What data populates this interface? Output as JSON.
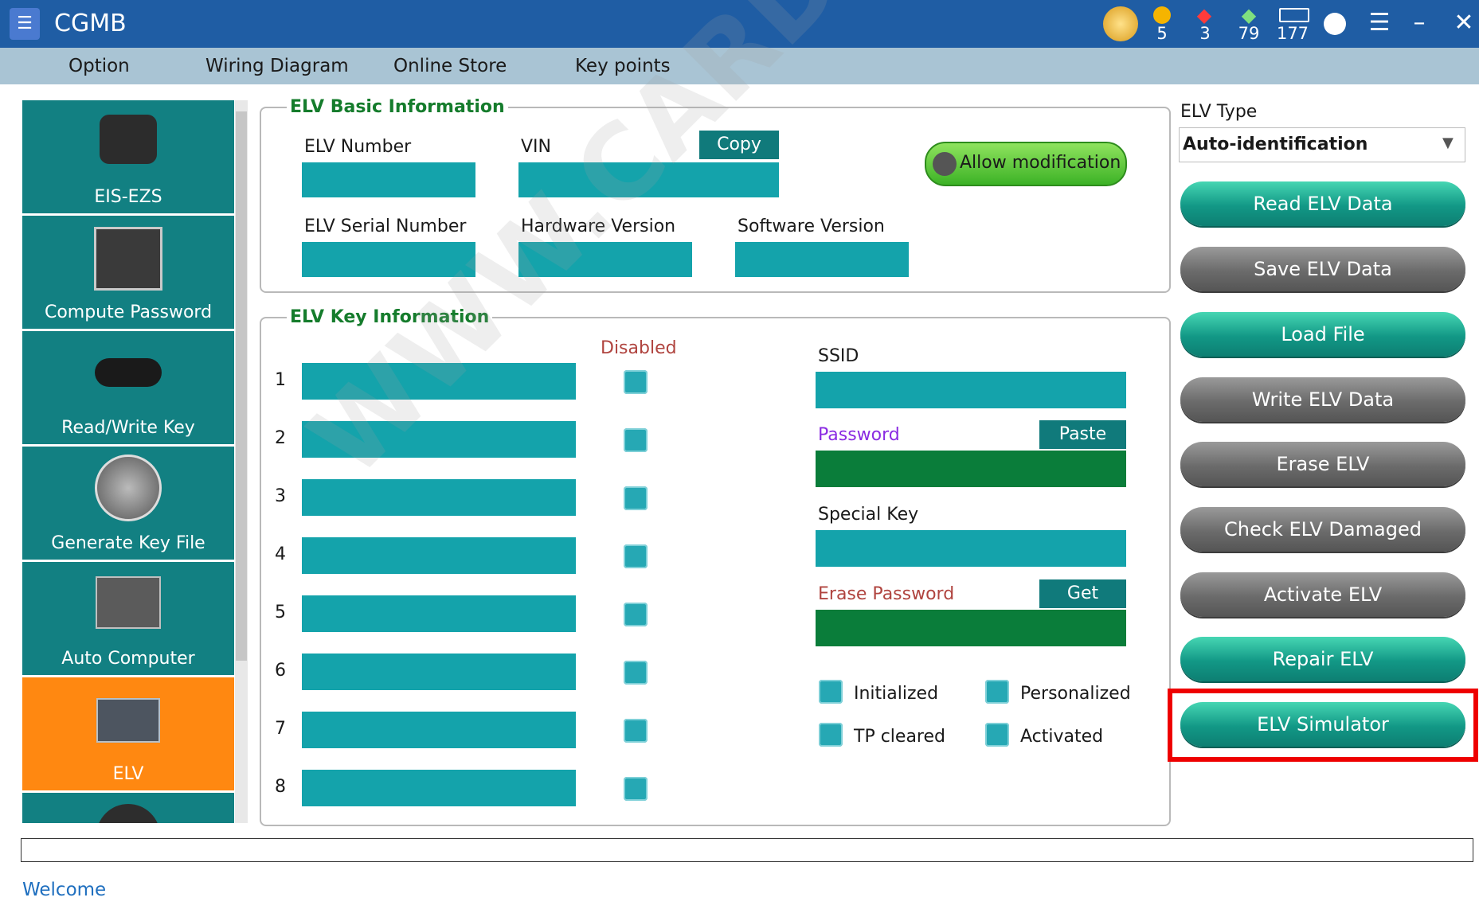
{
  "app": {
    "title": "CGMB",
    "counters": [
      {
        "icon": "gold-coin-icon",
        "value": "5"
      },
      {
        "icon": "red-gem-icon",
        "value": "3"
      },
      {
        "icon": "green-gem-icon",
        "value": "79"
      },
      {
        "icon": "chip-icon",
        "value": "177"
      }
    ]
  },
  "menu": [
    "Option",
    "Wiring Diagram",
    "Online Store",
    "Key points"
  ],
  "sidebar": {
    "items": [
      {
        "label": "EIS-EZS",
        "icon": "ignition-switch-icon"
      },
      {
        "label": "Compute Password",
        "icon": "chip-board-icon"
      },
      {
        "label": "Read/Write Key",
        "icon": "car-key-icon"
      },
      {
        "label": "Generate Key File",
        "icon": "printer-icon"
      },
      {
        "label": "Auto Computer",
        "icon": "ecu-icon"
      },
      {
        "label": "ELV",
        "icon": "elv-module-icon",
        "active": true
      }
    ]
  },
  "basic": {
    "title": "ELV Basic Information",
    "elv_number_label": "ELV Number",
    "vin_label": "VIN",
    "copy_label": "Copy",
    "allow_label": "Allow modification",
    "serial_label": "ELV Serial Number",
    "hardware_label": "Hardware Version",
    "software_label": "Software Version"
  },
  "keyinfo": {
    "title": "ELV Key Information",
    "disabled_label": "Disabled",
    "rows": [
      "1",
      "2",
      "3",
      "4",
      "5",
      "6",
      "7",
      "8"
    ],
    "ssid_label": "SSID",
    "password_label": "Password",
    "paste_label": "Paste",
    "special_label": "Special Key",
    "erase_label": "Erase Password",
    "get_label": "Get",
    "status": [
      "Initialized",
      "Personalized",
      "TP cleared",
      "Activated"
    ]
  },
  "right": {
    "type_label": "ELV Type",
    "type_value": "Auto-identification",
    "buttons": [
      {
        "label": "Read ELV Data",
        "style": "teal"
      },
      {
        "label": "Save ELV Data",
        "style": "gray"
      },
      {
        "label": "Load File",
        "style": "teal"
      },
      {
        "label": "Write ELV Data",
        "style": "gray"
      },
      {
        "label": "Erase ELV",
        "style": "gray"
      },
      {
        "label": "Check ELV Damaged",
        "style": "gray"
      },
      {
        "label": "Activate ELV",
        "style": "gray"
      },
      {
        "label": "Repair ELV",
        "style": "teal"
      },
      {
        "label": "ELV Simulator",
        "style": "teal",
        "highlighted": true
      }
    ]
  },
  "status_text": "Welcome",
  "watermark": "WWW.CARDIAGTOOL.CO.UK",
  "colors": {
    "titlebar": "#1f5da4",
    "teal": "#128082",
    "active": "#ff8811",
    "field": "#14a3ab",
    "highlight": "#ee0000"
  }
}
